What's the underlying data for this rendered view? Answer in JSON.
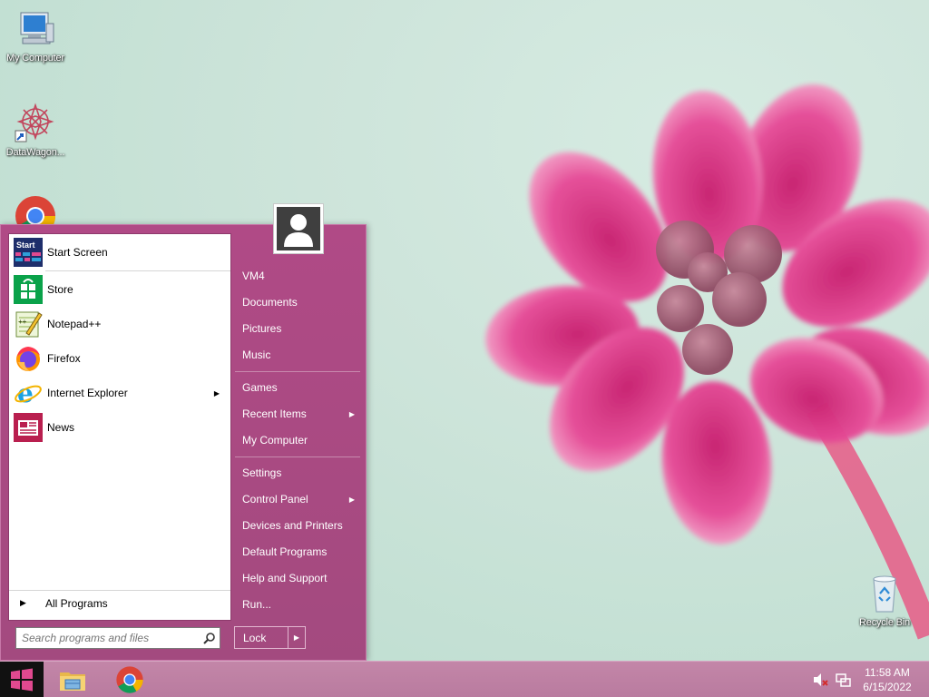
{
  "desktop": {
    "icons": [
      {
        "label": "My Computer",
        "icon": "computer-icon"
      },
      {
        "label": "DataWagon...",
        "icon": "datawagon-icon"
      },
      {
        "label": "Recycle Bin",
        "icon": "recycle-bin-icon"
      }
    ]
  },
  "start_menu": {
    "pinned": [
      {
        "label": "Start Screen",
        "icon": "start-screen-icon"
      },
      {
        "label": "Store",
        "icon": "store-icon"
      },
      {
        "label": "Notepad++",
        "icon": "notepadpp-icon"
      },
      {
        "label": "Firefox",
        "icon": "firefox-icon"
      },
      {
        "label": "Internet Explorer",
        "icon": "ie-icon",
        "submenu": true
      },
      {
        "label": "News",
        "icon": "news-icon"
      }
    ],
    "start_screen_glyph": "Start",
    "all_programs": "All Programs",
    "search_placeholder": "Search programs and files",
    "right_links": [
      {
        "label": "VM4"
      },
      {
        "label": "Documents"
      },
      {
        "label": "Pictures"
      },
      {
        "label": "Music"
      },
      {
        "label": "Games"
      },
      {
        "label": "Recent Items",
        "submenu": true
      },
      {
        "label": "My Computer"
      },
      {
        "label": "Settings"
      },
      {
        "label": "Control Panel",
        "submenu": true
      },
      {
        "label": "Devices and Printers"
      },
      {
        "label": "Default Programs"
      },
      {
        "label": "Help and Support"
      },
      {
        "label": "Run..."
      }
    ],
    "lock_label": "Lock"
  },
  "taskbar": {
    "pinned": [
      {
        "icon": "file-explorer-icon"
      },
      {
        "icon": "chrome-icon"
      }
    ],
    "clock": {
      "time": "11:58 AM",
      "date": "6/15/2022"
    }
  },
  "colors": {
    "start_menu_bg": "#a84a82",
    "taskbar_bg": "#bf81a4",
    "accent": "#e0498f"
  }
}
